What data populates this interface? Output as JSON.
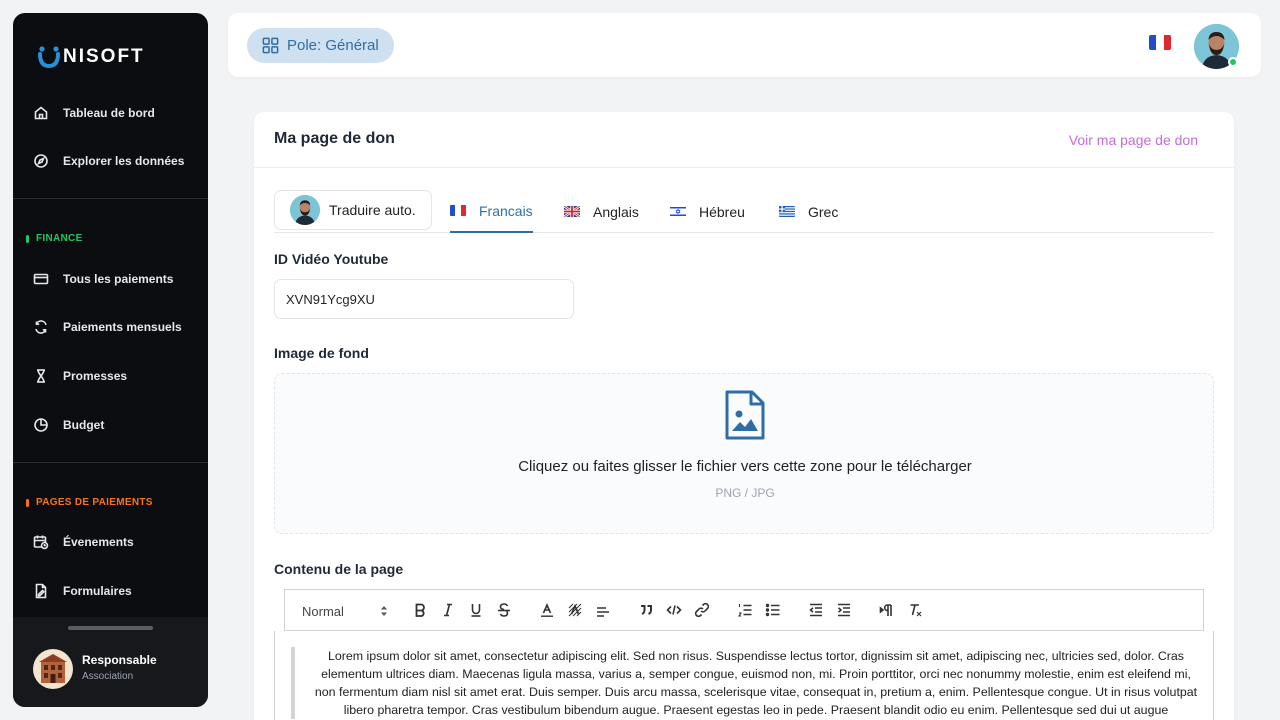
{
  "brand": {
    "logo_text": "NISOFT"
  },
  "sidebar": {
    "items_top": [
      {
        "label": "Tableau de bord",
        "icon": "home-icon"
      },
      {
        "label": "Explorer les données",
        "icon": "compass-icon"
      }
    ],
    "finance": {
      "label": "FINANCE",
      "color": "#22c55e",
      "items": [
        {
          "label": "Tous les paiements",
          "icon": "credit-card-icon"
        },
        {
          "label": "Paiements mensuels",
          "icon": "refresh-icon"
        },
        {
          "label": "Promesses",
          "icon": "hourglass-icon"
        },
        {
          "label": "Budget",
          "icon": "pie-chart-icon"
        }
      ]
    },
    "payment_pages": {
      "label": "PAGES DE PAIEMENTS",
      "color": "#f97316",
      "items": [
        {
          "label": "Évenements",
          "icon": "calendar-clock-icon"
        },
        {
          "label": "Formulaires",
          "icon": "file-edit-icon"
        }
      ]
    },
    "profile": {
      "name": "Responsable",
      "role": "Association"
    }
  },
  "topbar": {
    "pole_label": "Pole: Général",
    "language_flag": "fr-flag-icon"
  },
  "card": {
    "title": "Ma page de don",
    "link": "Voir ma page de don",
    "translate_button": "Traduire auto.",
    "tabs": [
      {
        "label": "Francais",
        "active": true
      },
      {
        "label": "Anglais",
        "active": false
      },
      {
        "label": "Hébreu",
        "active": false
      },
      {
        "label": "Grec",
        "active": false
      }
    ],
    "youtube": {
      "label": "ID Vidéo Youtube",
      "value": "XVN91Ycg9XU"
    },
    "background": {
      "label": "Image de fond",
      "drop_text": "Cliquez ou faites glisser le fichier vers cette zone pour le télécharger",
      "formats": "PNG / JPG"
    },
    "content": {
      "label": "Contenu de la page",
      "format_select": "Normal",
      "body": "Lorem ipsum dolor sit amet, consectetur adipiscing elit. Sed non risus. Suspendisse lectus tortor, dignissim sit amet, adipiscing nec, ultricies sed, dolor. Cras elementum ultrices diam. Maecenas ligula massa, varius a, semper congue, euismod non, mi. Proin porttitor, orci nec nonummy molestie, enim est eleifend mi, non fermentum diam nisl sit amet erat. Duis semper. Duis arcu massa, scelerisque vitae, consequat in, pretium a, enim. Pellentesque congue. Ut in risus volutpat libero pharetra tempor. Cras vestibulum bibendum augue. Praesent egestas leo in pede. Praesent blandit odio eu enim. Pellentesque sed dui ut augue"
    }
  },
  "colors": {
    "accent": "#2f6ea5",
    "link": "#c26dd9",
    "sidebar_bg": "#0c0d10"
  }
}
